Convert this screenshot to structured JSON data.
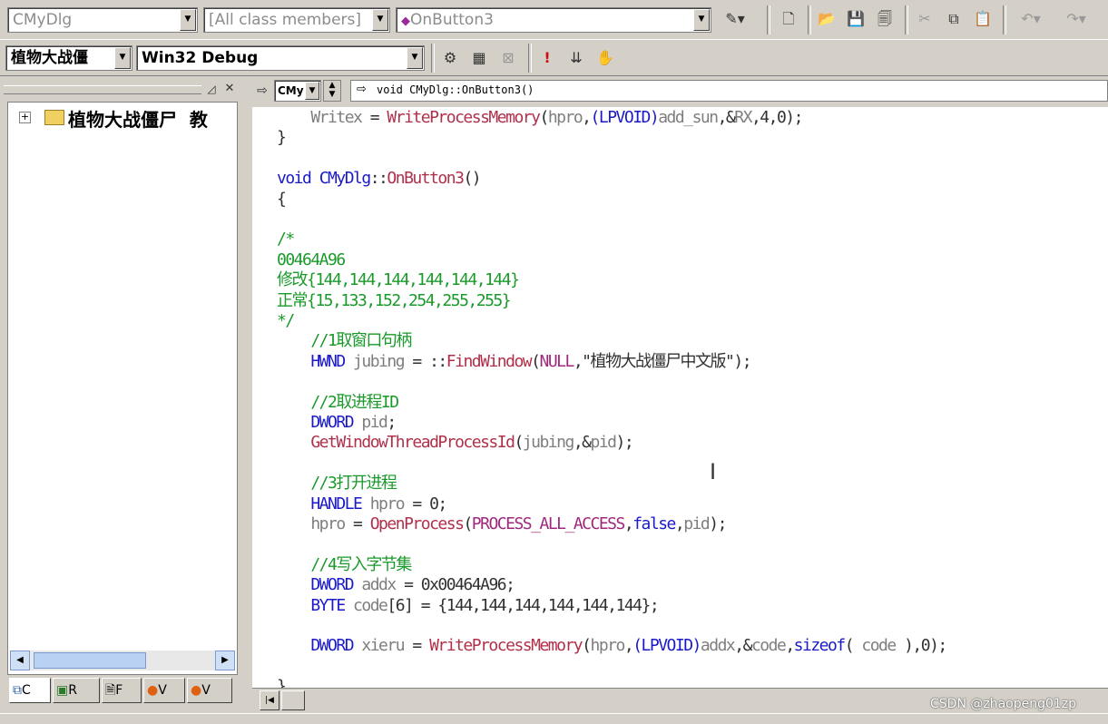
{
  "toolbar1": {
    "class_combo": "CMyDlg",
    "filter_combo": "[All class members]",
    "member_combo": "OnButton3"
  },
  "toolbar2": {
    "project_combo": "植物大战僵",
    "config_combo": "Win32 Debug"
  },
  "workspace": {
    "tree_root": "植物大战僵尸  教",
    "tabs": [
      "C",
      "R",
      "F",
      "V",
      "V"
    ]
  },
  "editor_nav": {
    "class_combo": "CMy",
    "function_label": "void CMyDlg::OnButton3()"
  },
  "code": {
    "lines": [
      [
        [
          "id",
          "    Writex"
        ],
        [
          "pn",
          " = "
        ],
        [
          "fn",
          "WriteProcessMemory"
        ],
        [
          "pn",
          "("
        ],
        [
          "id",
          "hpro"
        ],
        [
          "pn",
          ","
        ],
        [
          "kw",
          "(LPVOID)"
        ],
        [
          "id",
          "add_sun"
        ],
        [
          "pn",
          ",&"
        ],
        [
          "id",
          "RX"
        ],
        [
          "pn",
          ",4,0);"
        ]
      ],
      [
        [
          "pn",
          "}"
        ]
      ],
      [],
      [
        [
          "kw",
          "void "
        ],
        [
          "kw",
          "CMyDlg"
        ],
        [
          "pn",
          "::"
        ],
        [
          "fn",
          "OnButton3"
        ],
        [
          "pn",
          "()"
        ]
      ],
      [
        [
          "pn",
          "{"
        ]
      ],
      [],
      [
        [
          "cm",
          "/*"
        ]
      ],
      [
        [
          "cm",
          "00464A96"
        ]
      ],
      [
        [
          "cm",
          "修改{144,144,144,144,144,144}"
        ]
      ],
      [
        [
          "cm",
          "正常{15,133,152,254,255,255}"
        ]
      ],
      [
        [
          "cm",
          "*/"
        ]
      ],
      [
        [
          "cm",
          "    //1取窗口句柄"
        ]
      ],
      [
        [
          "kw",
          "    HWND "
        ],
        [
          "id",
          "jubing"
        ],
        [
          "pn",
          " = ::"
        ],
        [
          "fn",
          "FindWindow"
        ],
        [
          "pn",
          "("
        ],
        [
          "ct",
          "NULL"
        ],
        [
          "pn",
          ",\"植物大战僵尸中文版\");"
        ]
      ],
      [],
      [
        [
          "cm",
          "    //2取进程ID"
        ]
      ],
      [
        [
          "kw",
          "    DWORD "
        ],
        [
          "id",
          "pid"
        ],
        [
          "pn",
          ";"
        ]
      ],
      [
        [
          "fn",
          "    GetWindowThreadProcessId"
        ],
        [
          "pn",
          "("
        ],
        [
          "id",
          "jubing"
        ],
        [
          "pn",
          ",&"
        ],
        [
          "id",
          "pid"
        ],
        [
          "pn",
          ");"
        ]
      ],
      [],
      [
        [
          "cm",
          "    //3打开进程"
        ]
      ],
      [
        [
          "kw",
          "    HANDLE "
        ],
        [
          "id",
          "hpro"
        ],
        [
          "pn",
          " = 0;"
        ]
      ],
      [
        [
          "id",
          "    hpro"
        ],
        [
          "pn",
          " = "
        ],
        [
          "fn",
          "OpenProcess"
        ],
        [
          "pn",
          "("
        ],
        [
          "ct",
          "PROCESS_ALL_ACCESS"
        ],
        [
          "pn",
          ","
        ],
        [
          "kw",
          "false"
        ],
        [
          "pn",
          ","
        ],
        [
          "id",
          "pid"
        ],
        [
          "pn",
          ");"
        ]
      ],
      [],
      [
        [
          "cm",
          "    //4写入字节集"
        ]
      ],
      [
        [
          "kw",
          "    DWORD "
        ],
        [
          "id",
          "addx"
        ],
        [
          "pn",
          " = 0x00464A96;"
        ]
      ],
      [
        [
          "kw",
          "    BYTE "
        ],
        [
          "id",
          "code"
        ],
        [
          "pn",
          "[6] = {144,144,144,144,144,144};"
        ]
      ],
      [],
      [
        [
          "kw",
          "    DWORD "
        ],
        [
          "id",
          "xieru"
        ],
        [
          "pn",
          " = "
        ],
        [
          "fn",
          "WriteProcessMemory"
        ],
        [
          "pn",
          "("
        ],
        [
          "id",
          "hpro"
        ],
        [
          "pn",
          ","
        ],
        [
          "kw",
          "(LPVOID)"
        ],
        [
          "id",
          "addx"
        ],
        [
          "pn",
          ",&"
        ],
        [
          "id",
          "code"
        ],
        [
          "pn",
          ","
        ],
        [
          "kw",
          "sizeof"
        ],
        [
          "pn",
          "( "
        ],
        [
          "id",
          "code"
        ],
        [
          "pn",
          " ),0);"
        ]
      ],
      [],
      [
        [
          "pn",
          "}"
        ]
      ]
    ]
  },
  "watermark": "CSDN @zhaopeng01zp"
}
